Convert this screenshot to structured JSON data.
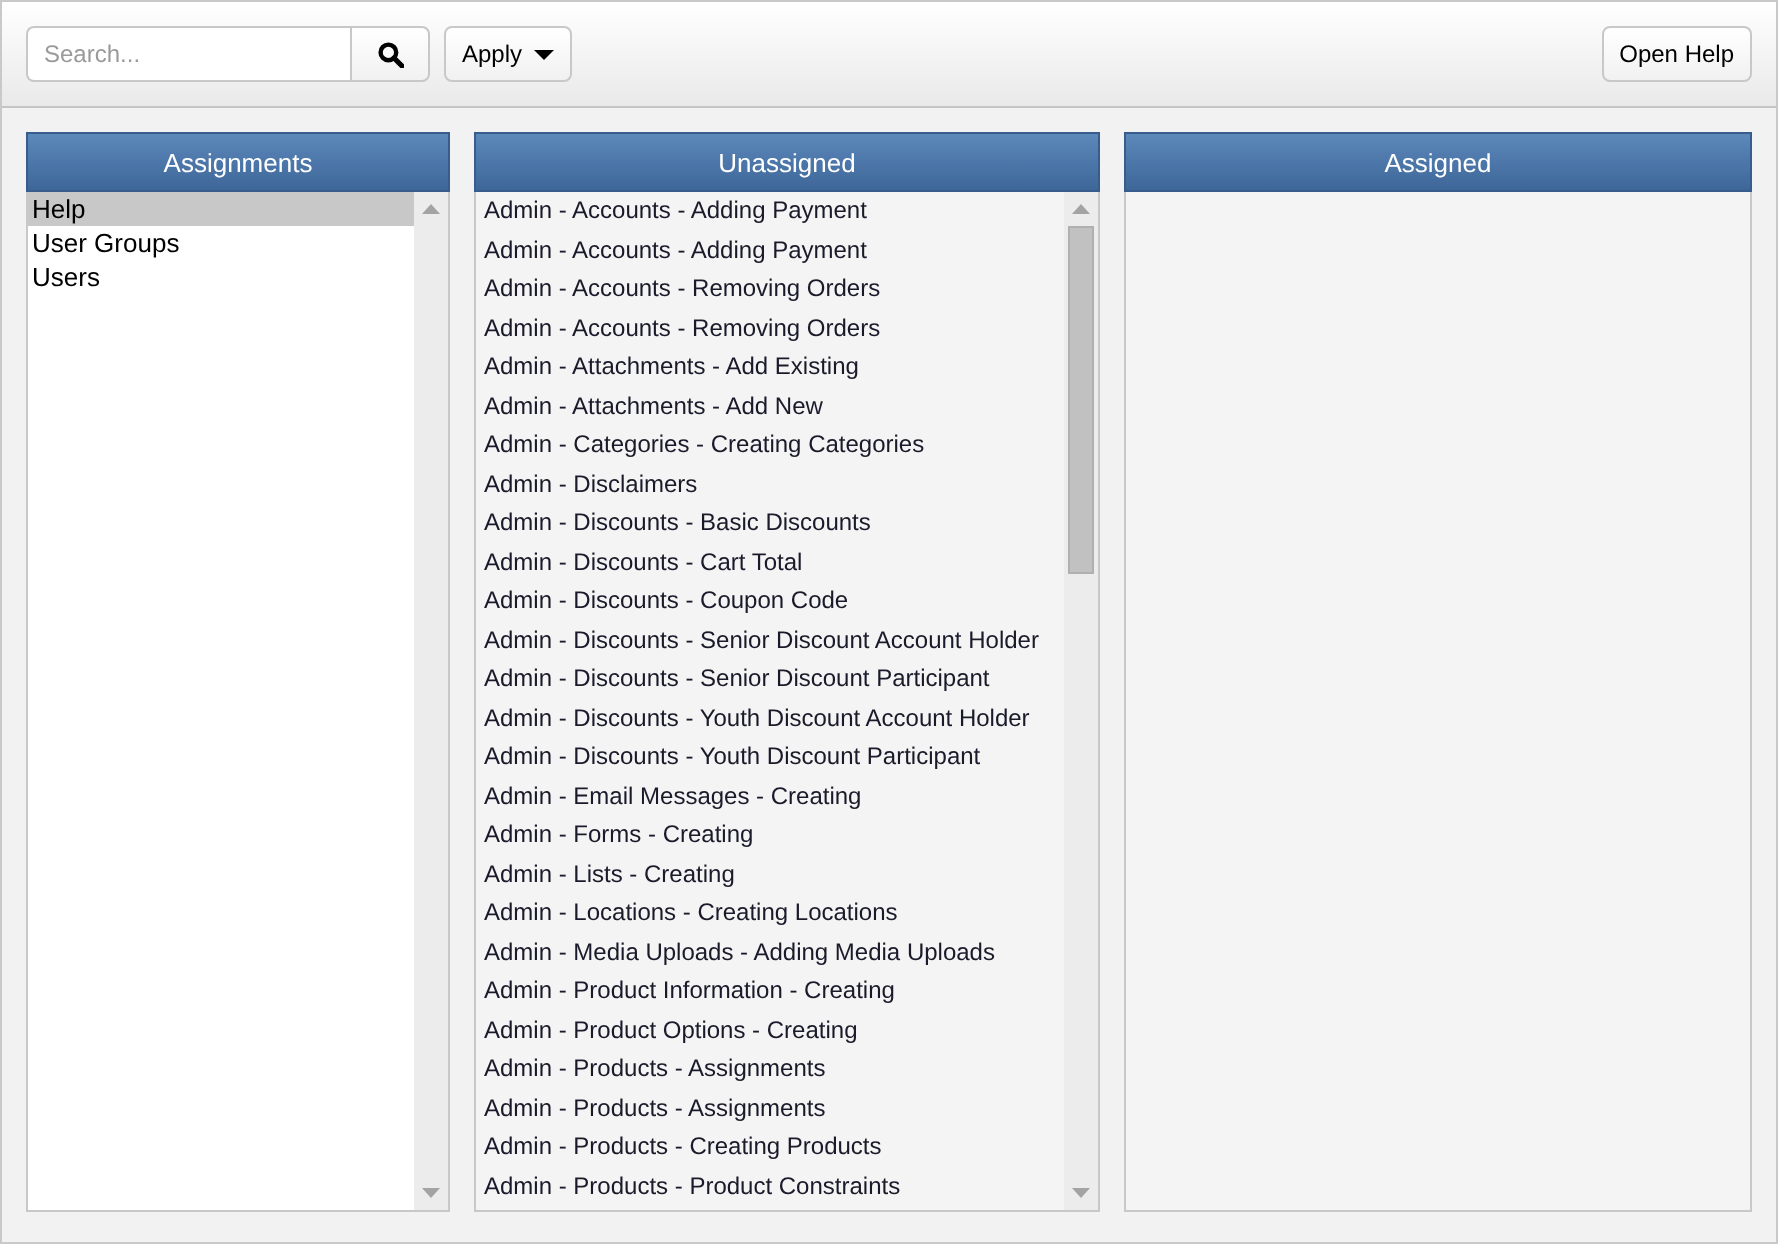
{
  "toolbar": {
    "search": {
      "placeholder": "Search..."
    },
    "apply_button": {
      "label": "Apply"
    },
    "help_button": {
      "label": "Open Help"
    }
  },
  "assignments": {
    "title": "Assignments",
    "items": [
      {
        "label": "Help",
        "selected": true
      },
      {
        "label": "User Groups",
        "selected": false
      },
      {
        "label": "Users",
        "selected": false
      }
    ]
  },
  "unassigned": {
    "title": "Unassigned",
    "items": [
      {
        "label": "Admin - Accounts - Adding Payment",
        "selected": false
      },
      {
        "label": "Admin - Accounts - Adding Payment",
        "selected": false
      },
      {
        "label": "Admin - Accounts - Removing Orders",
        "selected": false
      },
      {
        "label": "Admin - Accounts - Removing Orders",
        "selected": false
      },
      {
        "label": "Admin - Attachments - Add Existing",
        "selected": false
      },
      {
        "label": "Admin - Attachments - Add New",
        "selected": false
      },
      {
        "label": "Admin - Categories - Creating Categories",
        "selected": false
      },
      {
        "label": "Admin - Disclaimers",
        "selected": false
      },
      {
        "label": "Admin - Discounts - Basic Discounts",
        "selected": false
      },
      {
        "label": "Admin - Discounts - Cart Total",
        "selected": false
      },
      {
        "label": "Admin - Discounts - Coupon Code",
        "selected": false
      },
      {
        "label": "Admin - Discounts - Senior Discount Account Holder",
        "selected": false
      },
      {
        "label": "Admin - Discounts - Senior Discount Participant",
        "selected": false
      },
      {
        "label": "Admin - Discounts - Youth Discount Account Holder",
        "selected": false
      },
      {
        "label": "Admin - Discounts - Youth Discount Participant",
        "selected": false
      },
      {
        "label": "Admin - Email Messages - Creating",
        "selected": false
      },
      {
        "label": "Admin - Forms - Creating",
        "selected": false
      },
      {
        "label": "Admin - Lists - Creating",
        "selected": false
      },
      {
        "label": "Admin - Locations - Creating Locations",
        "selected": false
      },
      {
        "label": "Admin - Media Uploads - Adding Media Uploads",
        "selected": false
      },
      {
        "label": "Admin - Product Information - Creating",
        "selected": false
      },
      {
        "label": "Admin - Product Options - Creating",
        "selected": false
      },
      {
        "label": "Admin - Products - Assignments",
        "selected": false
      },
      {
        "label": "Admin - Products - Assignments",
        "selected": false
      },
      {
        "label": "Admin - Products - Creating Products",
        "selected": false
      },
      {
        "label": "Admin - Products - Product Constraints",
        "selected": false
      }
    ]
  },
  "assigned": {
    "title": "Assigned"
  }
}
